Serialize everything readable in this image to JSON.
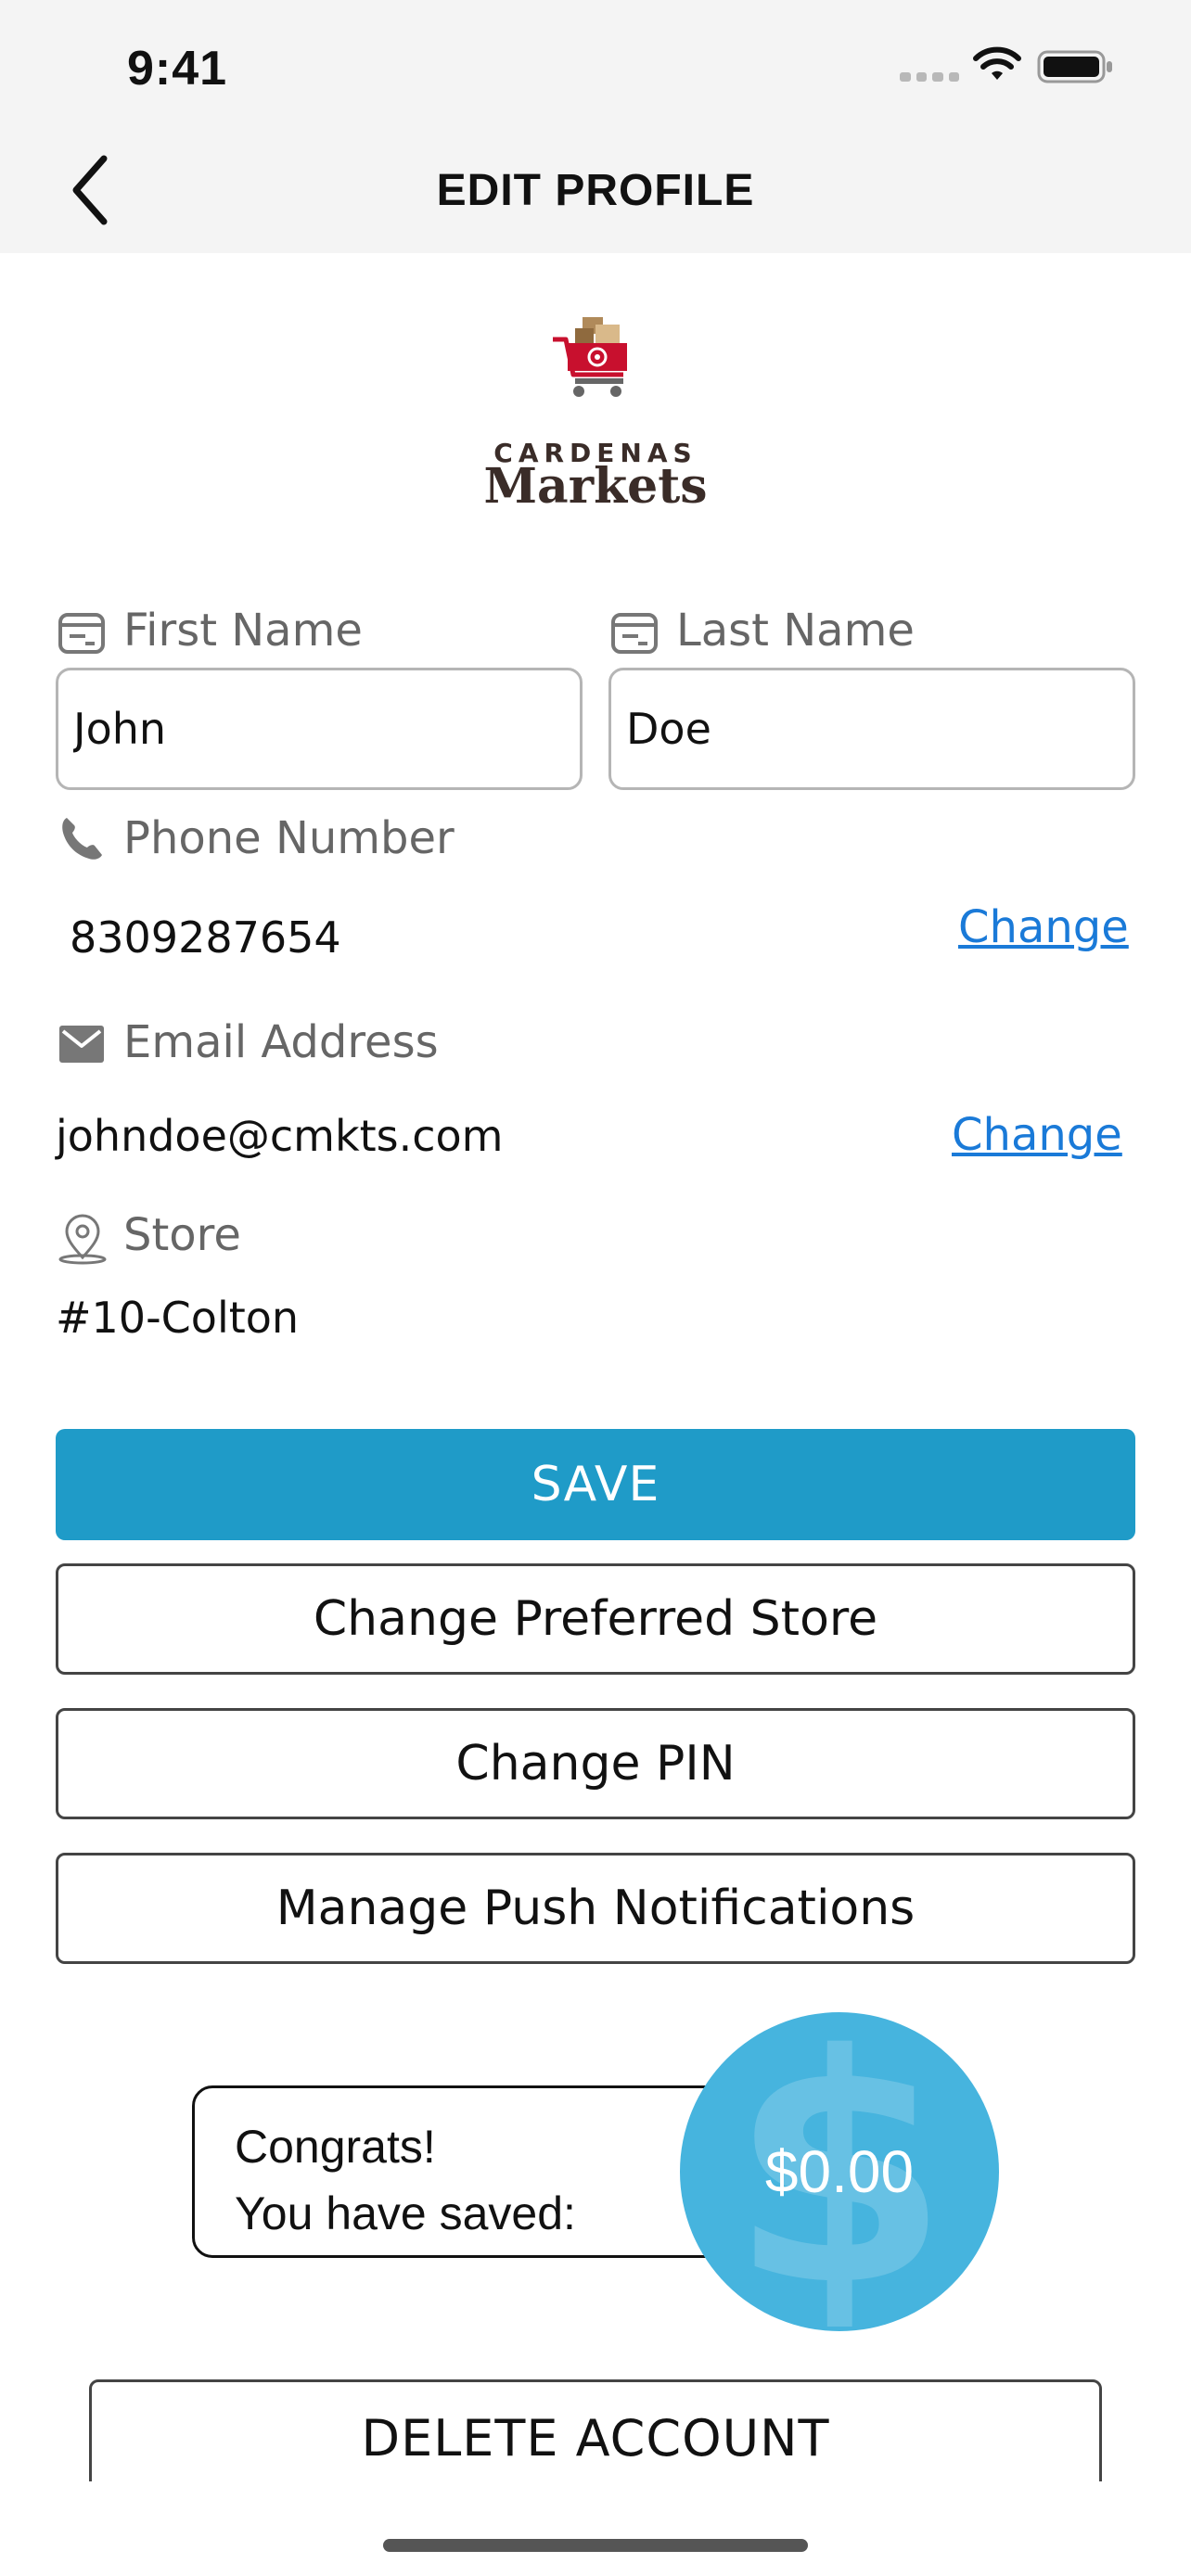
{
  "status_bar": {
    "time": "9:41"
  },
  "header": {
    "title": "EDIT PROFILE",
    "back_icon": "chevron-left-icon"
  },
  "logo": {
    "line1": "CARDENAS",
    "line2": "Markets",
    "icon": "shopping-cart-logo",
    "brand_color": "#c8102e",
    "text_color": "#3a2c28"
  },
  "form": {
    "first_name": {
      "label": "First Name",
      "value": "John",
      "icon": "id-card-icon"
    },
    "last_name": {
      "label": "Last Name",
      "value": "Doe",
      "icon": "id-card-icon"
    },
    "phone": {
      "label": "Phone Number",
      "value": "8309287654",
      "change_label": "Change",
      "icon": "phone-icon"
    },
    "email": {
      "label": "Email Address",
      "value": "johndoe@cmkts.com",
      "change_label": "Change",
      "icon": "envelope-icon"
    },
    "store": {
      "label": "Store",
      "value": "#10-Colton",
      "icon": "map-pin-icon"
    }
  },
  "actions": {
    "save": "SAVE",
    "change_store": "Change Preferred Store",
    "change_pin": "Change PIN",
    "push_notifications": "Manage Push Notifications",
    "delete_account": "DELETE ACCOUNT"
  },
  "savings": {
    "line1": "Congrats!",
    "line2": "You have saved:",
    "amount": "$0.00",
    "circle_color": "#46b4de"
  },
  "colors": {
    "primary": "#1f9bc8",
    "link": "#1a7ad8",
    "header_bg": "#f4f4f4"
  }
}
